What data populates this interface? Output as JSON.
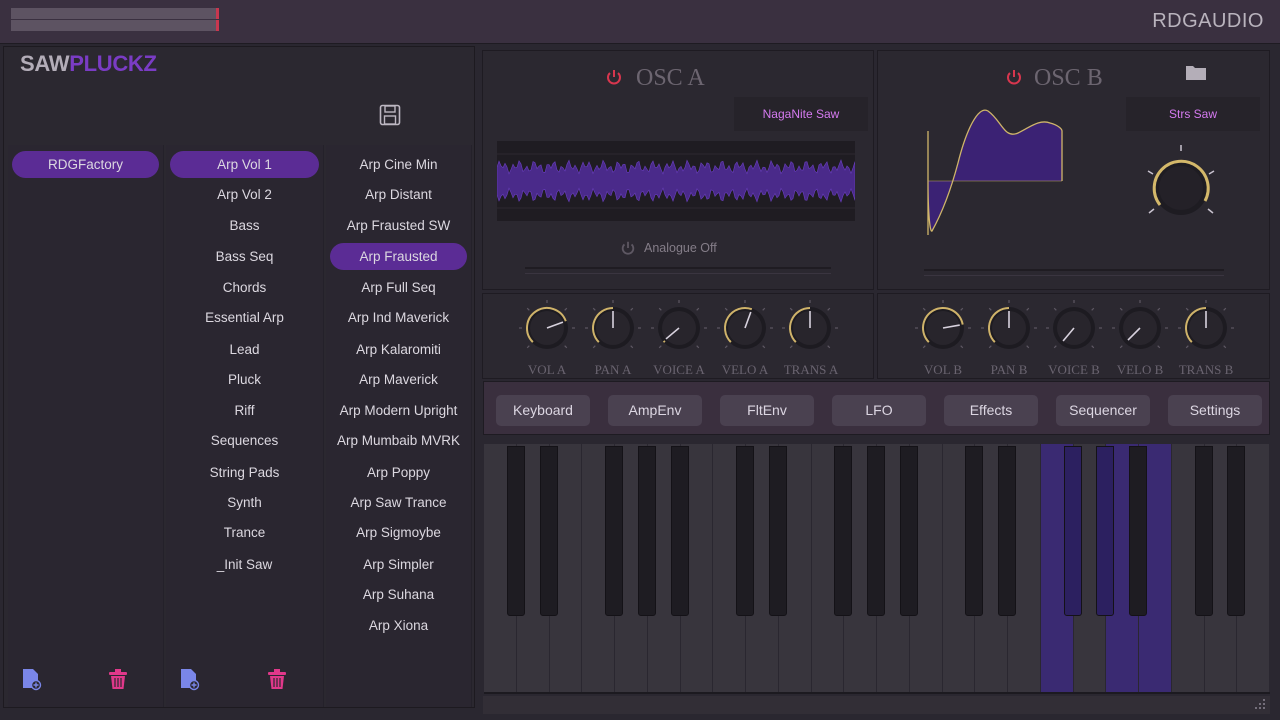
{
  "header": {
    "brand": "RDGAUDIO"
  },
  "logo": {
    "part1": "SAW",
    "part2": "PLUCKZ"
  },
  "browser": {
    "banks": [
      "RDGFactory"
    ],
    "categories": [
      "Arp Vol 1",
      "Arp Vol 2",
      "Bass",
      "Bass Seq",
      "Chords",
      "Essential Arp",
      "Lead",
      "Pluck",
      "Riff",
      "Sequences",
      "String Pads",
      "Synth",
      "Trance",
      "_Init Saw"
    ],
    "presets": [
      "Arp Cine Min",
      "Arp Distant",
      "Arp Frausted SW",
      "Arp Frausted",
      "Arp Full Seq",
      "Arp Ind Maverick",
      "Arp Kalaromiti",
      "Arp Maverick",
      "Arp Modern Upright",
      "Arp Mumbaib MVRK",
      "Arp Poppy",
      "Arp Saw Trance",
      "Arp Sigmoybe",
      "Arp Simpler",
      "Arp Suhana",
      "Arp Xiona"
    ]
  },
  "oscA": {
    "title": "OSC A",
    "wave": "NagaNite Saw",
    "analogue": "Analogue Off"
  },
  "oscB": {
    "title": "OSC B",
    "wave": "Strs Saw"
  },
  "knobsA": [
    "VOL A",
    "PAN A",
    "VOICE A",
    "VELO A",
    "TRANS A"
  ],
  "knobsB": [
    "VOL B",
    "PAN B",
    "VOICE B",
    "VELO B",
    "TRANS B"
  ],
  "tabs": [
    "Keyboard",
    "AmpEnv",
    "FltEnv",
    "LFO",
    "Effects",
    "Sequencer",
    "Settings"
  ],
  "colors": {
    "accent": "#5b2c95",
    "logo_accent": "#7a3cc4",
    "power": "#c8374f",
    "pink_icon": "#e0388a",
    "wave_text": "#d57af0"
  }
}
